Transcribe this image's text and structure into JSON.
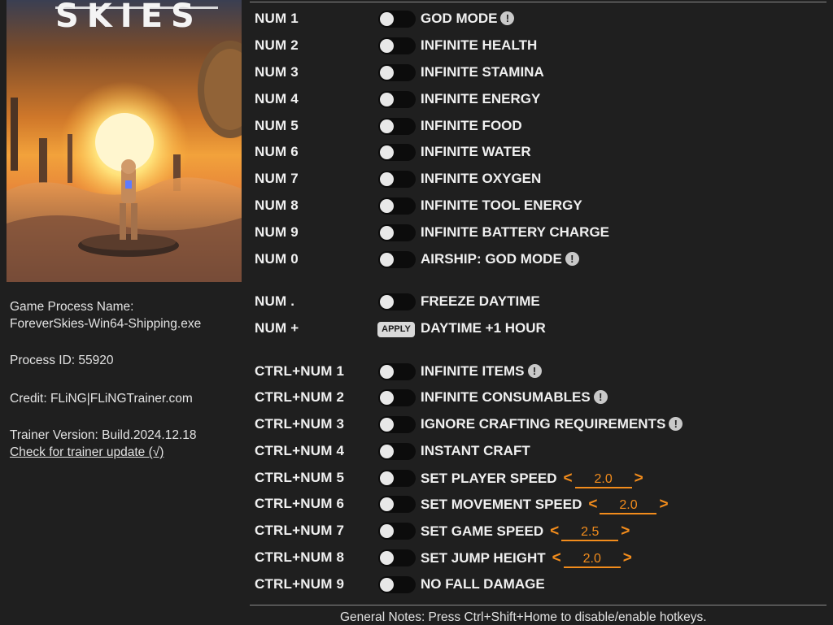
{
  "game": {
    "logo_text": "SKIES",
    "process_label": "Game Process Name:",
    "process_name": "ForeverSkies-Win64-Shipping.exe",
    "process_id": "Process ID: 55920",
    "credit": "Credit: FLiNG|FLiNGTrainer.com",
    "version": "Trainer Version: Build.2024.12.18",
    "update_link": "Check for trainer update (√)"
  },
  "cheats": [
    {
      "hotkey": "NUM 1",
      "label": "GOD MODE",
      "warn": "!"
    },
    {
      "hotkey": "NUM 2",
      "label": "INFINITE HEALTH"
    },
    {
      "hotkey": "NUM 3",
      "label": "INFINITE STAMINA"
    },
    {
      "hotkey": "NUM 4",
      "label": "INFINITE ENERGY"
    },
    {
      "hotkey": "NUM 5",
      "label": "INFINITE FOOD"
    },
    {
      "hotkey": "NUM 6",
      "label": "INFINITE WATER"
    },
    {
      "hotkey": "NUM 7",
      "label": "INFINITE OXYGEN"
    },
    {
      "hotkey": "NUM 8",
      "label": "INFINITE TOOL ENERGY"
    },
    {
      "hotkey": "NUM 9",
      "label": "INFINITE BATTERY CHARGE"
    },
    {
      "hotkey": "NUM 0",
      "label": "AIRSHIP: GOD MODE",
      "warn": "!"
    },
    {
      "hotkey": "NUM .",
      "label": "FREEZE DAYTIME"
    },
    {
      "hotkey": "NUM +",
      "label": "DAYTIME +1 HOUR",
      "apply": "APPLY"
    },
    {
      "hotkey": "CTRL+NUM 1",
      "label": "INFINITE ITEMS",
      "warn": "!"
    },
    {
      "hotkey": "CTRL+NUM 2",
      "label": "INFINITE CONSUMABLES",
      "warn": "!"
    },
    {
      "hotkey": "CTRL+NUM 3",
      "label": "IGNORE CRAFTING REQUIREMENTS",
      "warn": "!"
    },
    {
      "hotkey": "CTRL+NUM 4",
      "label": "INSTANT CRAFT"
    },
    {
      "hotkey": "CTRL+NUM 5",
      "label": "SET PLAYER SPEED",
      "value": "2.0",
      "left": "<",
      "right": ">"
    },
    {
      "hotkey": "CTRL+NUM 6",
      "label": "SET MOVEMENT SPEED",
      "value": "2.0",
      "left": "<",
      "right": ">"
    },
    {
      "hotkey": "CTRL+NUM 7",
      "label": "SET GAME SPEED",
      "value": "2.5",
      "left": "<",
      "right": ">"
    },
    {
      "hotkey": "CTRL+NUM 8",
      "label": "SET JUMP HEIGHT",
      "value": "2.0",
      "left": "<",
      "right": ">"
    },
    {
      "hotkey": "CTRL+NUM 9",
      "label": "NO FALL DAMAGE"
    }
  ],
  "notes": "General Notes: Press Ctrl+Shift+Home to disable/enable hotkeys.",
  "colors": {
    "accent": "#f28c1c",
    "background": "#1f1f1f",
    "toggle_track": "#0c0c0c",
    "knob": "#e8e8e8"
  }
}
